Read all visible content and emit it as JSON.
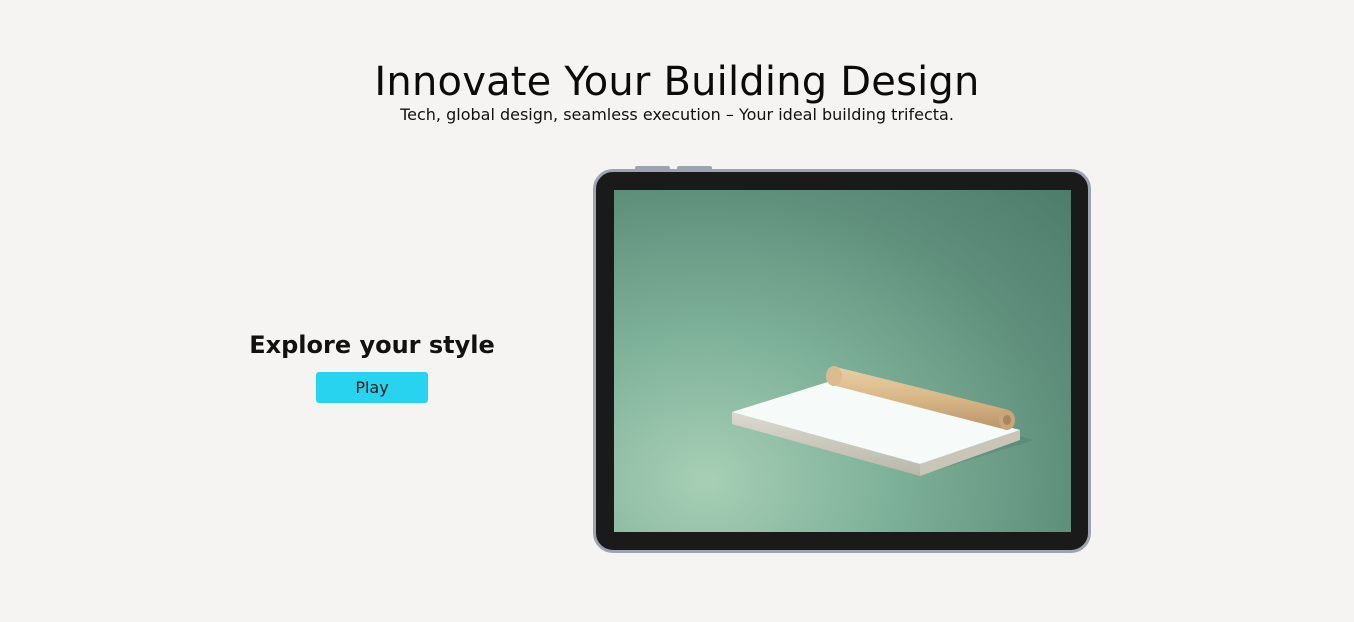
{
  "hero": {
    "title": "Innovate Your Building Design",
    "subtitle": "Tech, global design, seamless execution – Your ideal building trifecta."
  },
  "cta": {
    "heading_strong": "Explore",
    "heading_rest": " your style",
    "play_label": "Play"
  },
  "colors": {
    "background": "#f5f4f2",
    "accent": "#27d3ee",
    "tablet_frame": "#9ea3b2",
    "tablet_bezel": "#1a1a1a"
  },
  "media": {
    "icon": "paper-roll-illustration"
  }
}
